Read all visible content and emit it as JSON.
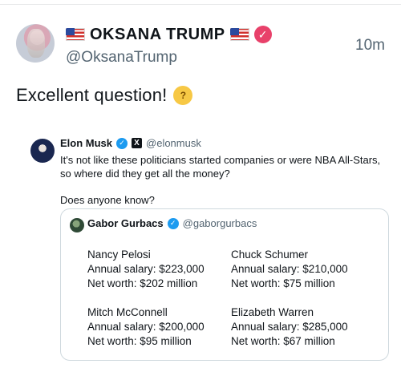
{
  "tweet": {
    "display_name": "OKSANA TRUMP",
    "handle": "@OksanaTrump",
    "time": "10m",
    "text": "Excellent question!"
  },
  "icons": {
    "flag": "us-flag-icon",
    "verified": "verified-pink-icon",
    "emoji": "thinking-face-emoji"
  },
  "quoted_tweet": {
    "name": "Elon Musk",
    "handle": "@elonmusk",
    "text_line1": "It's not like these politicians started companies or were NBA All-Stars, so where did they get all the money?",
    "text_line2": "Does anyone know?",
    "inner": {
      "name": "Gabor Gurbacs",
      "handle": "@gaborgurbacs",
      "politicians": [
        {
          "name": "Nancy Pelosi",
          "salary": "Annual salary: $223,000",
          "worth": "Net worth: $202 million"
        },
        {
          "name": "Chuck Schumer",
          "salary": "Annual salary: $210,000",
          "worth": "Net worth: $75 million"
        },
        {
          "name": "Mitch McConnell",
          "salary": "Annual salary: $200,000",
          "worth": "Net worth: $95 million"
        },
        {
          "name": "Elizabeth Warren",
          "salary": "Annual salary: $285,000",
          "worth": "Net worth: $67 million"
        }
      ]
    }
  },
  "colors": {
    "verified_pink": "#e8416a",
    "verified_blue": "#1d9bf0",
    "muted_text": "#536471",
    "border": "#cfd9de"
  }
}
